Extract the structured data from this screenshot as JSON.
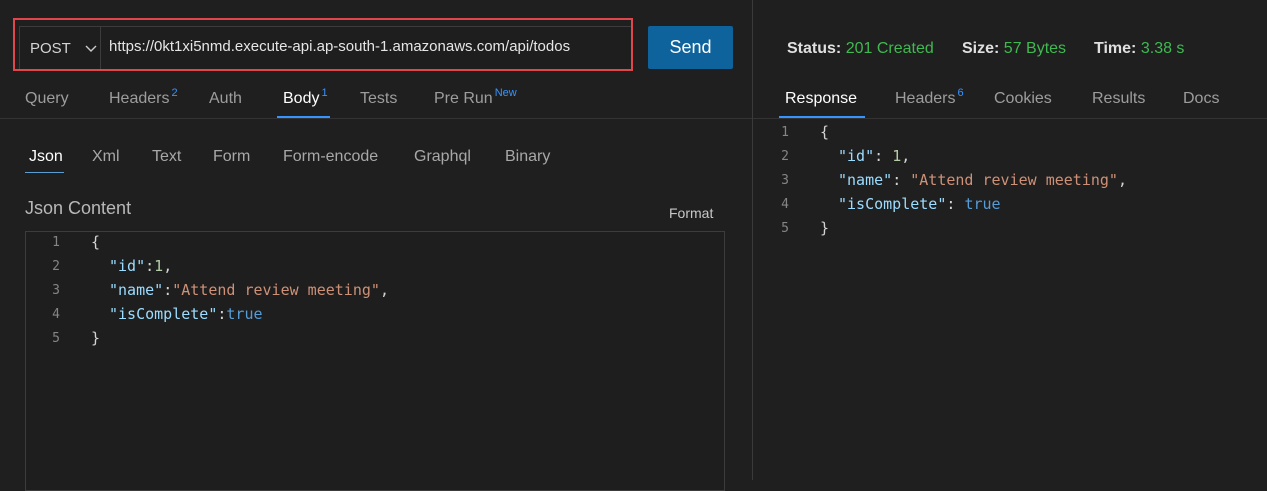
{
  "request": {
    "method": "POST",
    "url": "https://0kt1xi5nmd.execute-api.ap-south-1.amazonaws.com/api/todos",
    "send_label": "Send"
  },
  "request_tabs": [
    {
      "label": "Query",
      "badge": ""
    },
    {
      "label": "Headers",
      "badge": "2"
    },
    {
      "label": "Auth",
      "badge": ""
    },
    {
      "label": "Body",
      "badge": "1"
    },
    {
      "label": "Tests",
      "badge": ""
    },
    {
      "label": "Pre Run",
      "badge": "New"
    }
  ],
  "body_tabs": [
    "Json",
    "Xml",
    "Text",
    "Form",
    "Form-encode",
    "Graphql",
    "Binary"
  ],
  "json_content": {
    "title": "Json Content",
    "format_label": "Format",
    "lines": [
      {
        "n": "1",
        "text": "{"
      },
      {
        "n": "2",
        "key": "\"id\"",
        "sep": ":",
        "val": "1",
        "tail": ","
      },
      {
        "n": "3",
        "key": "\"name\"",
        "sep": ":",
        "val": "\"Attend review meeting\"",
        "tail": ","
      },
      {
        "n": "4",
        "key": "\"isComplete\"",
        "sep": ":",
        "val": "true",
        "tail": ""
      },
      {
        "n": "5",
        "text": "}"
      }
    ]
  },
  "status": {
    "status_label": "Status:",
    "status_value": "201 Created",
    "size_label": "Size:",
    "size_value": "57 Bytes",
    "time_label": "Time:",
    "time_value": "3.38 s"
  },
  "response_tabs": [
    {
      "label": "Response",
      "badge": ""
    },
    {
      "label": "Headers",
      "badge": "6"
    },
    {
      "label": "Cookies",
      "badge": ""
    },
    {
      "label": "Results",
      "badge": ""
    },
    {
      "label": "Docs",
      "badge": ""
    }
  ],
  "response_body": {
    "lines": [
      {
        "n": "1",
        "text": "{"
      },
      {
        "n": "2",
        "key": "\"id\"",
        "sep": ": ",
        "val": "1",
        "tail": ","
      },
      {
        "n": "3",
        "key": "\"name\"",
        "sep": ": ",
        "val": "\"Attend review meeting\"",
        "tail": ","
      },
      {
        "n": "4",
        "key": "\"isComplete\"",
        "sep": ": ",
        "val": "true",
        "tail": ""
      },
      {
        "n": "5",
        "text": "}"
      }
    ]
  },
  "colors": {
    "accent": "#3794ff",
    "send_bg": "#0e639c",
    "status_ok": "#3fb950",
    "highlight": "#e0474d"
  }
}
